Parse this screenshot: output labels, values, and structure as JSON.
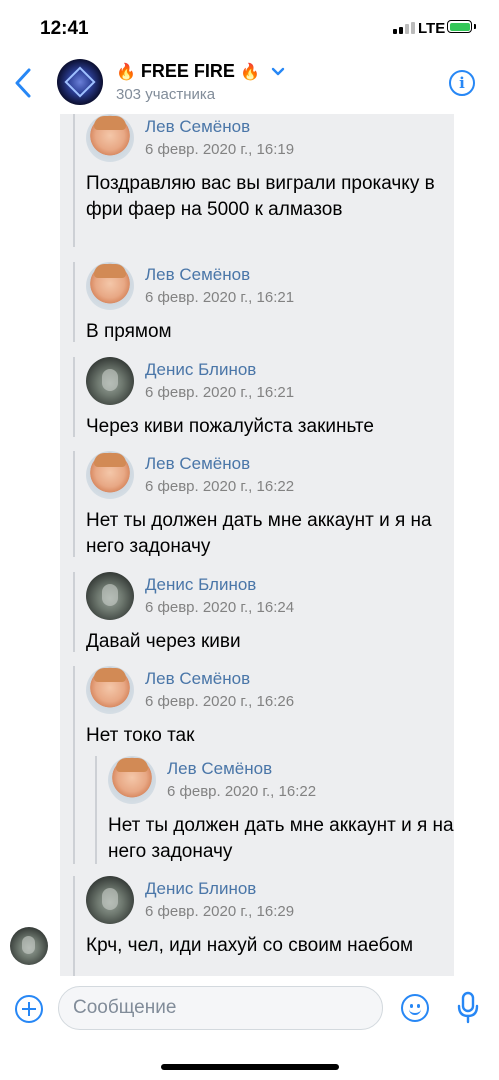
{
  "status": {
    "time": "12:41",
    "network": "LTE"
  },
  "header": {
    "title": "FREE FIRE",
    "title_emoji": "🔥",
    "participants": "303 участника"
  },
  "messages": [
    {
      "author": "Лев Семёнов",
      "time": "6 февр. 2020 г., 16:19",
      "text": "Поздравляю вас вы виграли прокачку в фри фаер на 5000 к алмазов"
    },
    {
      "author": "Лев Семёнов",
      "time": "6 февр. 2020 г., 16:21",
      "text": "В прямом"
    },
    {
      "author": "Денис Блинов",
      "time": "6 февр. 2020 г., 16:21",
      "text": "Через киви пожалуйста закиньте"
    },
    {
      "author": "Лев Семёнов",
      "time": "6 февр. 2020 г., 16:22",
      "text": "Нет ты должен дать мне аккаунт и я на него задоначу"
    },
    {
      "author": "Денис Блинов",
      "time": "6 февр. 2020 г., 16:24",
      "text": "Давай через киви"
    },
    {
      "author": "Лев Семёнов",
      "time": "6 февр. 2020 г., 16:26",
      "text": "Нет токо так"
    },
    {
      "author": "Лев Семёнов",
      "time": "6 февр. 2020 г., 16:22",
      "text": "Нет ты должен дать мне аккаунт и я на него задоначу"
    },
    {
      "author": "Денис Блинов",
      "time": "6 февр. 2020 г., 16:29",
      "text": "Крч, чел, иди нахуй со своим наебом"
    }
  ],
  "composer": {
    "placeholder": "Сообщение"
  },
  "colors": {
    "accent": "#2787f5",
    "author": "#4a76a8",
    "forward_bg": "#edeef0"
  },
  "icons": [
    "back-arrow-icon",
    "info-icon",
    "chevron-down-icon",
    "plus-icon",
    "emoji-icon",
    "microphone-icon"
  ]
}
